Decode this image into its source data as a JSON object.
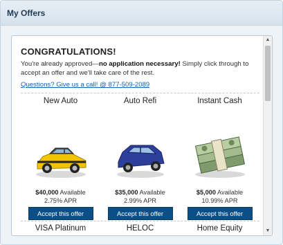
{
  "widget": {
    "title": "My Offers"
  },
  "panel": {
    "heading": "CONGRATULATIONS!",
    "message_pre": "You're already approved—",
    "message_bold": "no application necessary!",
    "message_post": " Simply click through to accept an offer and we'll take care of the rest.",
    "phone_link": "Questions? Give us a call! @ 877-509-2089"
  },
  "offers": [
    {
      "title": "New Auto",
      "amount": "$40,000",
      "available": " Available",
      "apr": "2.75% APR",
      "button": "Accept this offer",
      "icon": "yellow-car-icon"
    },
    {
      "title": "Auto Refi",
      "amount": "$35,000",
      "available": " Available",
      "apr": "2.99% APR",
      "button": "Accept this offer",
      "icon": "blue-suv-icon"
    },
    {
      "title": "Instant Cash",
      "amount": "$5,000",
      "available": " Available",
      "apr": "10.99% APR",
      "button": "Accept this offer",
      "icon": "cash-stack-icon"
    }
  ],
  "next_row": [
    "VISA Platinum",
    "HELOC",
    "Home Equity"
  ],
  "scroll": {
    "up": "▲",
    "down": "▼"
  }
}
